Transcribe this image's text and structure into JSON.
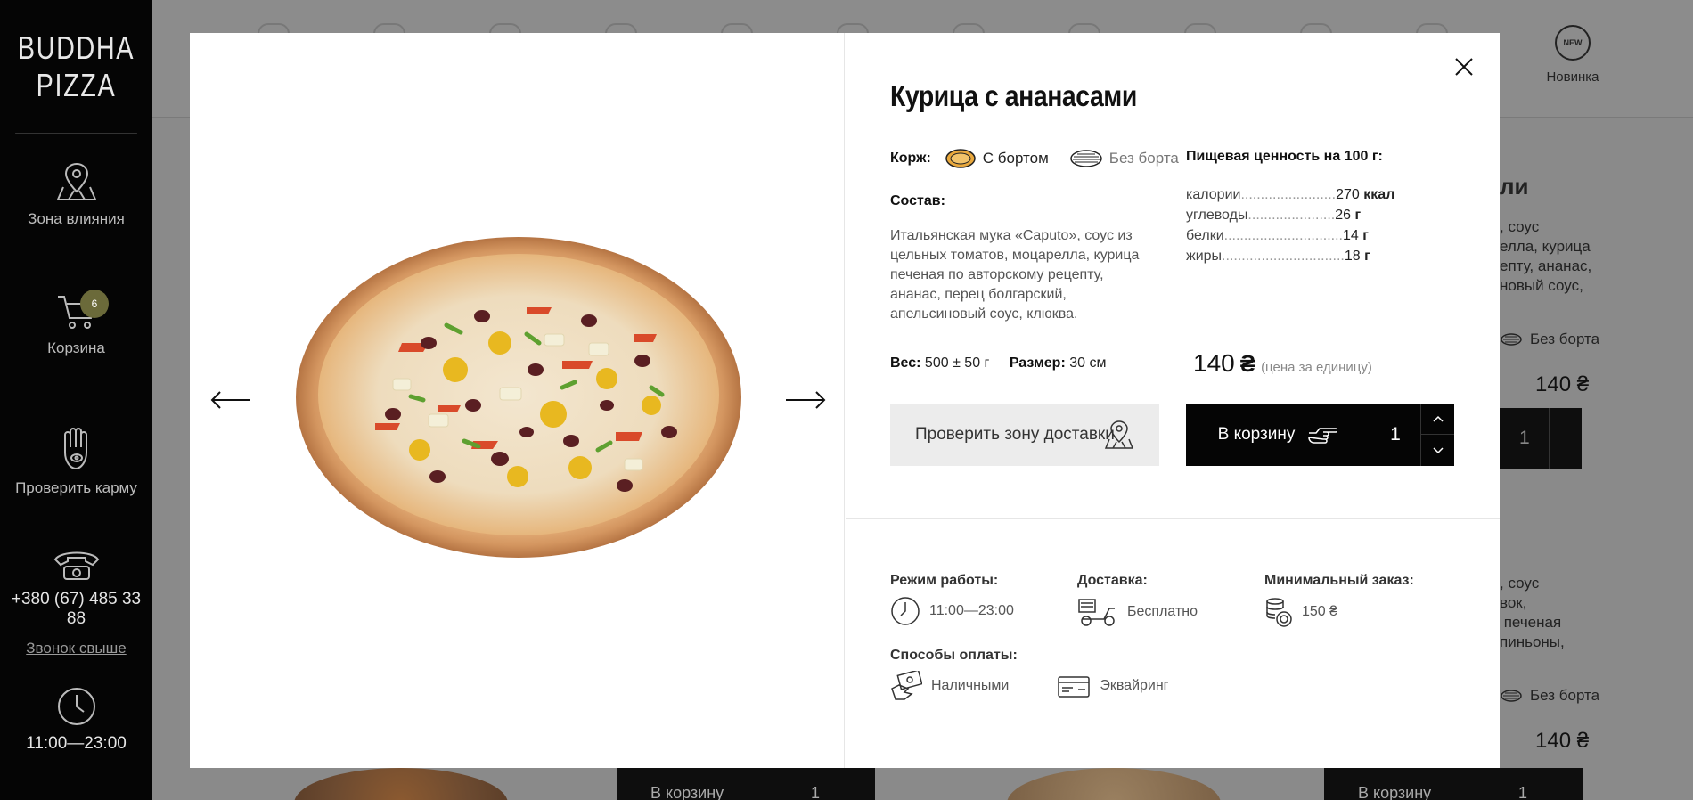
{
  "sidebar": {
    "logo_line1": "BUDDHA",
    "logo_line2": "PIZZA",
    "items": [
      {
        "label": "Зона влияния",
        "icon": "map-pin-icon"
      },
      {
        "label": "Корзина",
        "icon": "cart-icon",
        "badge": "6"
      },
      {
        "label": "Проверить карму",
        "icon": "hamsa-hand-icon"
      }
    ],
    "phone": "+380 (67) 485 33 88",
    "callback": "Звонок свыше",
    "hours": "11:00—23:00"
  },
  "topnav": {
    "new_badge": "NEW",
    "new_label": "Новинка"
  },
  "background": {
    "card1_title": "ли",
    "card1_text": ", соус\nелла, курица\nепту, ананас,\nновый соус,",
    "card1_crust_off": "Без борта",
    "card1_price": "140 ₴",
    "card1_qty": "1",
    "card2_text": ", соус\nвок,\n печеная\nпиньоны,",
    "card2_crust_off": "Без борта",
    "card2_price": "140 ₴",
    "bottom_cart_label": "В корзину",
    "bottom_qty": "1"
  },
  "modal": {
    "title": "Курица с ананасами",
    "crust_label": "Корж:",
    "crust_options": [
      {
        "label": "С бортом",
        "selected": true
      },
      {
        "label": "Без борта",
        "selected": false
      }
    ],
    "composition_label": "Состав:",
    "ingredients": "Итальянская мука «Caputo», соус из цельных томатов, моцарелла, курица печеная по авторскому рецепту, ананас, перец болгарский, апельсиновый соус, клюква.",
    "nutrition_title": "Пищевая ценность на 100 г:",
    "nutrition": [
      {
        "name": "калории",
        "value": "270",
        "unit": "ккал"
      },
      {
        "name": "углеводы",
        "value": "26",
        "unit": "г"
      },
      {
        "name": "белки",
        "value": "14",
        "unit": "г"
      },
      {
        "name": "жиры",
        "value": "18",
        "unit": "г"
      }
    ],
    "weight_label": "Вес:",
    "weight_value": "500 ± 50 г",
    "size_label": "Размер:",
    "size_value": "30 см",
    "price": "140",
    "currency": "₴",
    "price_note": "(цена за единицу)",
    "check_zone_label": "Проверить зону доставки",
    "add_to_cart_label": "В корзину",
    "quantity": "1",
    "info": {
      "hours_title": "Режим работы:",
      "hours_value": "11:00—23:00",
      "delivery_title": "Доставка:",
      "delivery_value": "Бесплатно",
      "min_order_title": "Минимальный заказ:",
      "min_order_value": "150 ₴",
      "payment_title": "Способы оплаты:",
      "payment_cash": "Наличными",
      "payment_card": "Эквайринг"
    }
  }
}
